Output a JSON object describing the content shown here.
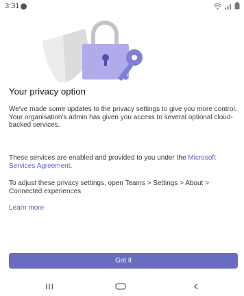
{
  "status_bar": {
    "time": "3:31",
    "wifi_icon": "wifi-icon",
    "signal_icon": "signal-icon",
    "battery_icon": "battery-icon"
  },
  "hero": {
    "illustration": "lock-and-key-illustration",
    "colors": {
      "lock_body": "#a7a3e6",
      "lock_shackle": "#bdbdbd",
      "key": "#7d7fd8",
      "shield": "#e9e9e9"
    }
  },
  "content": {
    "title": "Your privacy option",
    "paragraph_1": "We've made some updates to the privacy settings to give you more control. Your organisation's admin has given you access to several optional cloud-backed services.",
    "paragraph_2_prefix": "These services are enabled and provided to you under the ",
    "paragraph_2_link": "Microsoft Services Agreement",
    "paragraph_2_suffix": ".",
    "paragraph_3": "To adjust these privacy settings, open Teams > Settings > About > Connected experiences",
    "learn_more": "Learn more"
  },
  "actions": {
    "got_it_label": "Got it",
    "accent_color": "#6a6cc0"
  },
  "nav_bar": {
    "recent_icon": "recent-apps-icon",
    "home_icon": "home-icon",
    "back_icon": "back-icon"
  }
}
